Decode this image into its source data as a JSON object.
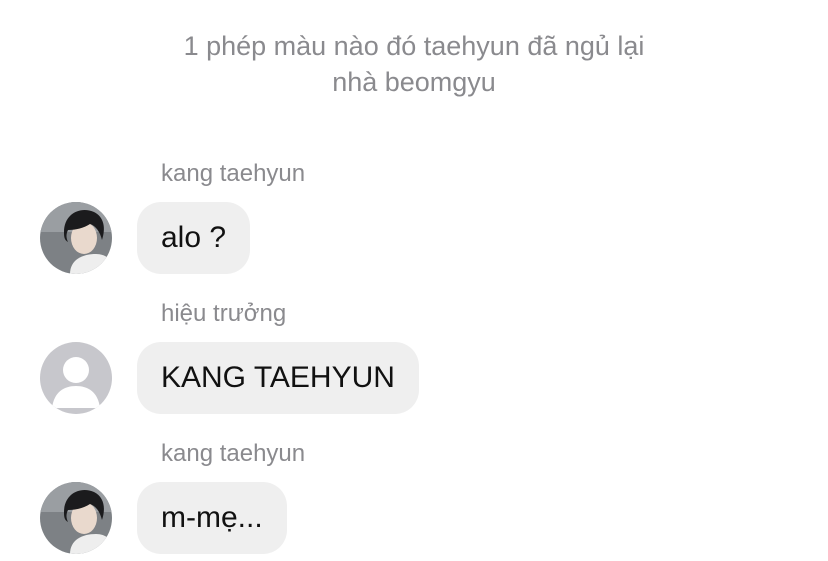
{
  "system_note": {
    "line1": "1 phép màu nào đó taehyun đã ngủ lại",
    "line2": "nhà beomgyu"
  },
  "messages": [
    {
      "sender": "kang taehyun",
      "text": "alo ?",
      "avatar": "profile-photo"
    },
    {
      "sender": "hiệu trưởng",
      "text": "KANG TAEHYUN",
      "avatar": "default-user-icon"
    },
    {
      "sender": "kang taehyun",
      "text": "m-mẹ...",
      "avatar": "profile-photo"
    }
  ],
  "colors": {
    "meta_text": "#8a8a8e",
    "bubble_bg": "#efefef",
    "message_text": "#111111",
    "default_avatar_bg": "#c7c7cc"
  }
}
